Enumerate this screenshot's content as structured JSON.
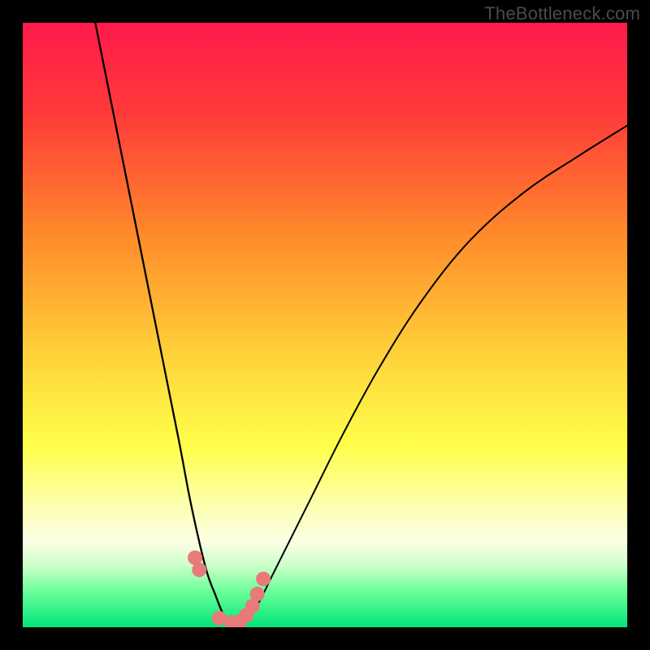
{
  "watermark": "TheBottleneck.com",
  "gradient": {
    "stops": [
      {
        "pct": 0,
        "color": "#ff1a4b"
      },
      {
        "pct": 15,
        "color": "#ff3a3a"
      },
      {
        "pct": 35,
        "color": "#ff8a2a"
      },
      {
        "pct": 55,
        "color": "#ffd23a"
      },
      {
        "pct": 70,
        "color": "#ffff4a"
      },
      {
        "pct": 80,
        "color": "#fdffb0"
      },
      {
        "pct": 86,
        "color": "#fbffe6"
      },
      {
        "pct": 90,
        "color": "#c8ffc8"
      },
      {
        "pct": 94,
        "color": "#6cff9a"
      },
      {
        "pct": 100,
        "color": "#00e57a"
      }
    ]
  },
  "chart_data": {
    "type": "line",
    "title": "",
    "xlabel": "",
    "ylabel": "",
    "xlim": [
      0,
      100
    ],
    "ylim": [
      0,
      100
    ],
    "series": [
      {
        "name": "left-curve",
        "x": [
          12,
          14,
          16,
          18,
          20,
          22,
          24,
          26,
          27.5,
          29,
          30.5,
          32,
          33,
          34,
          35
        ],
        "y": [
          100,
          90,
          80,
          70,
          60,
          50,
          40,
          30,
          22,
          15,
          9,
          5,
          2.5,
          1,
          0
        ]
      },
      {
        "name": "right-curve",
        "x": [
          35,
          37,
          39,
          41,
          44,
          48,
          53,
          59,
          66,
          74,
          83,
          92,
          100
        ],
        "y": [
          0,
          1.5,
          4,
          8,
          14,
          22,
          32,
          43,
          54,
          64,
          72,
          78,
          83
        ]
      },
      {
        "name": "valley-markers",
        "x": [
          28.5,
          29.2,
          32.5,
          34.5,
          36.0,
          37.0,
          38.0,
          38.8,
          39.8
        ],
        "y": [
          11.5,
          9.5,
          1.5,
          0.8,
          1.0,
          2.0,
          3.5,
          5.5,
          8.0
        ]
      }
    ],
    "marker_color": "#e87a7a",
    "curve_color": "#000000"
  }
}
